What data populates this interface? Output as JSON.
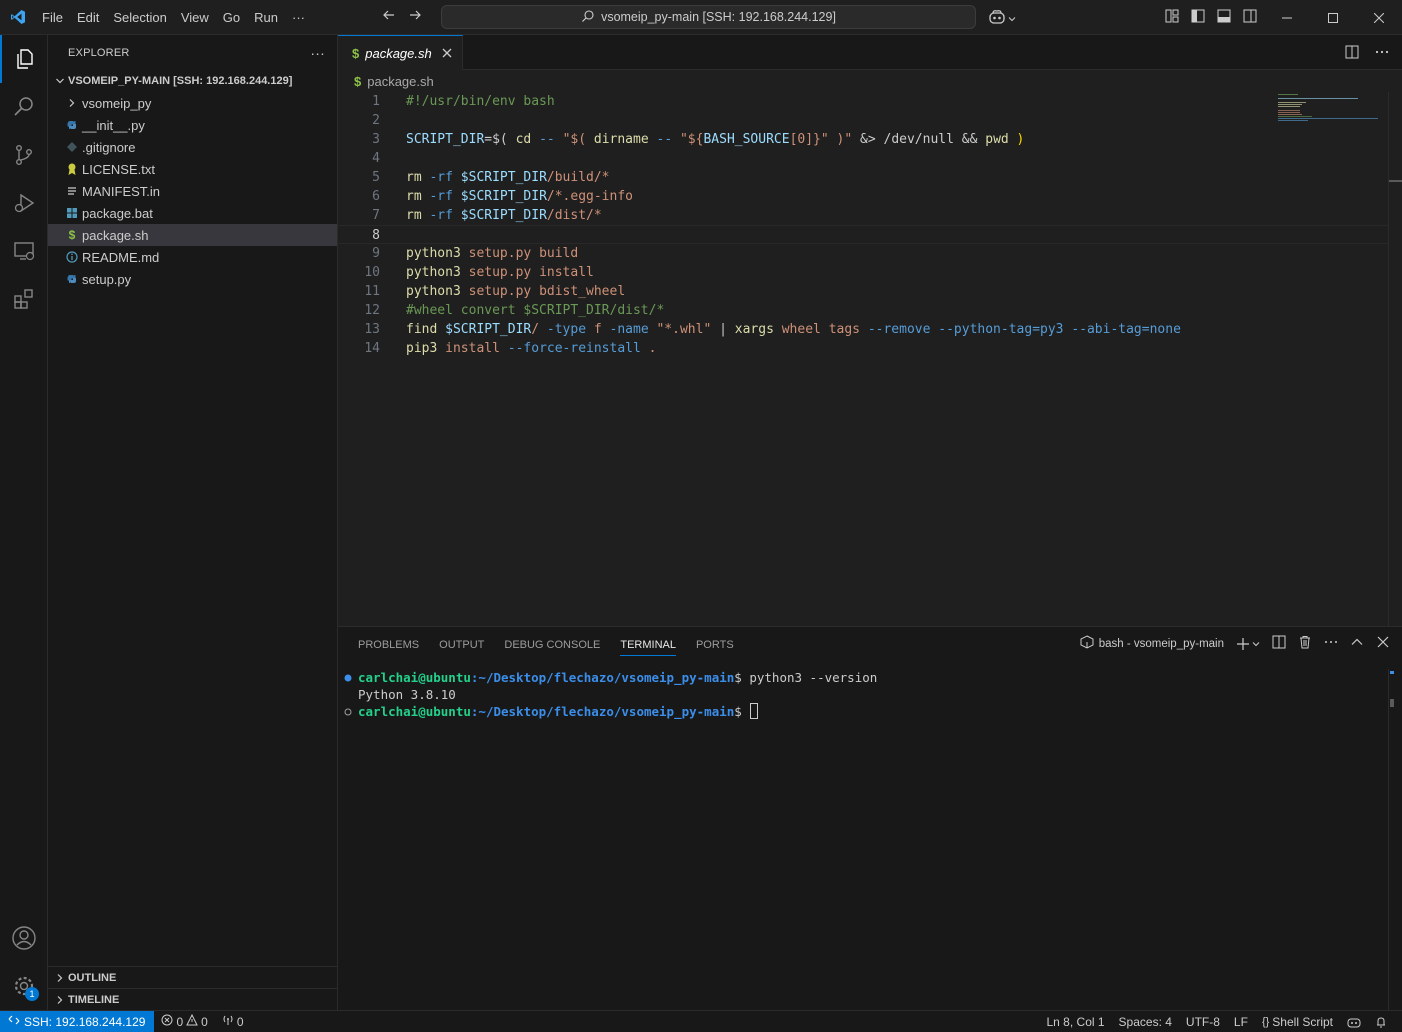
{
  "titlebar": {
    "menu": [
      "File",
      "Edit",
      "Selection",
      "View",
      "Go",
      "Run"
    ],
    "more": "···",
    "search_text": "vsomeip_py-main [SSH: 192.168.244.129]"
  },
  "sidebar": {
    "title": "EXPLORER",
    "more": "···",
    "folder": "VSOMEIP_PY-MAIN [SSH: 192.168.244.129]",
    "items": [
      {
        "label": "vsomeip_py",
        "icon": "chevron-right-icon",
        "kind": "folder"
      },
      {
        "label": "__init__.py",
        "icon": "python-icon",
        "kind": "file"
      },
      {
        "label": ".gitignore",
        "icon": "git-icon",
        "kind": "file"
      },
      {
        "label": "LICENSE.txt",
        "icon": "license-icon",
        "kind": "file"
      },
      {
        "label": "MANIFEST.in",
        "icon": "lines-icon",
        "kind": "file"
      },
      {
        "label": "package.bat",
        "icon": "windows-icon",
        "kind": "file"
      },
      {
        "label": "package.sh",
        "icon": "shell-icon",
        "kind": "file"
      },
      {
        "label": "README.md",
        "icon": "info-icon",
        "kind": "file"
      },
      {
        "label": "setup.py",
        "icon": "python-icon",
        "kind": "file"
      }
    ],
    "outline": "OUTLINE",
    "timeline": "TIMELINE"
  },
  "editor": {
    "tab_label": "package.sh",
    "tab_icon": "$",
    "breadcrumb": "package.sh",
    "lines": [
      [
        [
          "#!/usr/bin/env bash",
          "cm"
        ]
      ],
      [],
      [
        [
          "SCRIPT_DIR",
          "var"
        ],
        [
          "=$( ",
          "pl"
        ],
        [
          "cd",
          "cmd"
        ],
        [
          " -- ",
          "opt"
        ],
        [
          "\"$( ",
          "str"
        ],
        [
          "dirname",
          "cmd"
        ],
        [
          " -- ",
          "opt"
        ],
        [
          "\"${",
          "str"
        ],
        [
          "BASH_SOURCE",
          "var"
        ],
        [
          "[0]",
          "str"
        ],
        [
          "}\"",
          "str"
        ],
        [
          " )\"",
          "str"
        ],
        [
          " &> /dev/null && ",
          "pl"
        ],
        [
          "pwd",
          "cmd"
        ],
        [
          " )",
          "br"
        ]
      ],
      [],
      [
        [
          "rm",
          "cmd"
        ],
        [
          " -rf ",
          "opt"
        ],
        [
          "$SCRIPT_DIR",
          "var"
        ],
        [
          "/build/*",
          "str"
        ]
      ],
      [
        [
          "rm",
          "cmd"
        ],
        [
          " -rf ",
          "opt"
        ],
        [
          "$SCRIPT_DIR",
          "var"
        ],
        [
          "/*.egg-info",
          "str"
        ]
      ],
      [
        [
          "rm",
          "cmd"
        ],
        [
          " -rf ",
          "opt"
        ],
        [
          "$SCRIPT_DIR",
          "var"
        ],
        [
          "/dist/*",
          "str"
        ]
      ],
      [],
      [
        [
          "python3",
          "cmd"
        ],
        [
          " setup.py build",
          "str"
        ]
      ],
      [
        [
          "python3",
          "cmd"
        ],
        [
          " setup.py install",
          "str"
        ]
      ],
      [
        [
          "python3",
          "cmd"
        ],
        [
          " setup.py bdist_wheel",
          "str"
        ]
      ],
      [
        [
          "#wheel convert $SCRIPT_DIR/dist/*",
          "cm"
        ]
      ],
      [
        [
          "find",
          "cmd"
        ],
        [
          " ",
          "pl"
        ],
        [
          "$SCRIPT_DIR",
          "var"
        ],
        [
          "/",
          "str"
        ],
        [
          " -type",
          "opt"
        ],
        [
          " f ",
          "str"
        ],
        [
          "-name",
          "opt"
        ],
        [
          " \"*.whl\"",
          "str"
        ],
        [
          " | ",
          "pl"
        ],
        [
          "xargs",
          "cmd"
        ],
        [
          " wheel tags ",
          "str"
        ],
        [
          "--remove --python-tag=py3 --abi-tag=none",
          "opt"
        ]
      ],
      [
        [
          "pip3",
          "cmd"
        ],
        [
          " install ",
          "str"
        ],
        [
          "--force-reinstall",
          "opt"
        ],
        [
          " .",
          "str"
        ]
      ]
    ],
    "current_line": 8
  },
  "panel": {
    "tabs": [
      "PROBLEMS",
      "OUTPUT",
      "DEBUG CONSOLE",
      "TERMINAL",
      "PORTS"
    ],
    "active_tab": "TERMINAL",
    "terminal_name": "bash - vsomeip_py-main",
    "terminal": [
      {
        "user": "carlchai@ubuntu",
        "path": ":~/Desktop/flechazo/vsomeip_py-main",
        "cmd": "$ python3 --version",
        "dot": "filled"
      },
      {
        "out": "Python 3.8.10"
      },
      {
        "user": "carlchai@ubuntu",
        "path": ":~/Desktop/flechazo/vsomeip_py-main",
        "cmd": "$ ",
        "dot": "hollow",
        "cursor": true
      }
    ]
  },
  "statusbar": {
    "remote": "SSH: 192.168.244.129",
    "errors": "0",
    "warnings": "0",
    "ports": "0",
    "position": "Ln 8, Col 1",
    "spaces": "Spaces: 4",
    "encoding": "UTF-8",
    "eol": "LF",
    "language": "Shell Script"
  },
  "accounts_badge": "1",
  "colors": {
    "accent": "#0078d4",
    "background": "#1f1f1f",
    "sidebar": "#181818"
  }
}
